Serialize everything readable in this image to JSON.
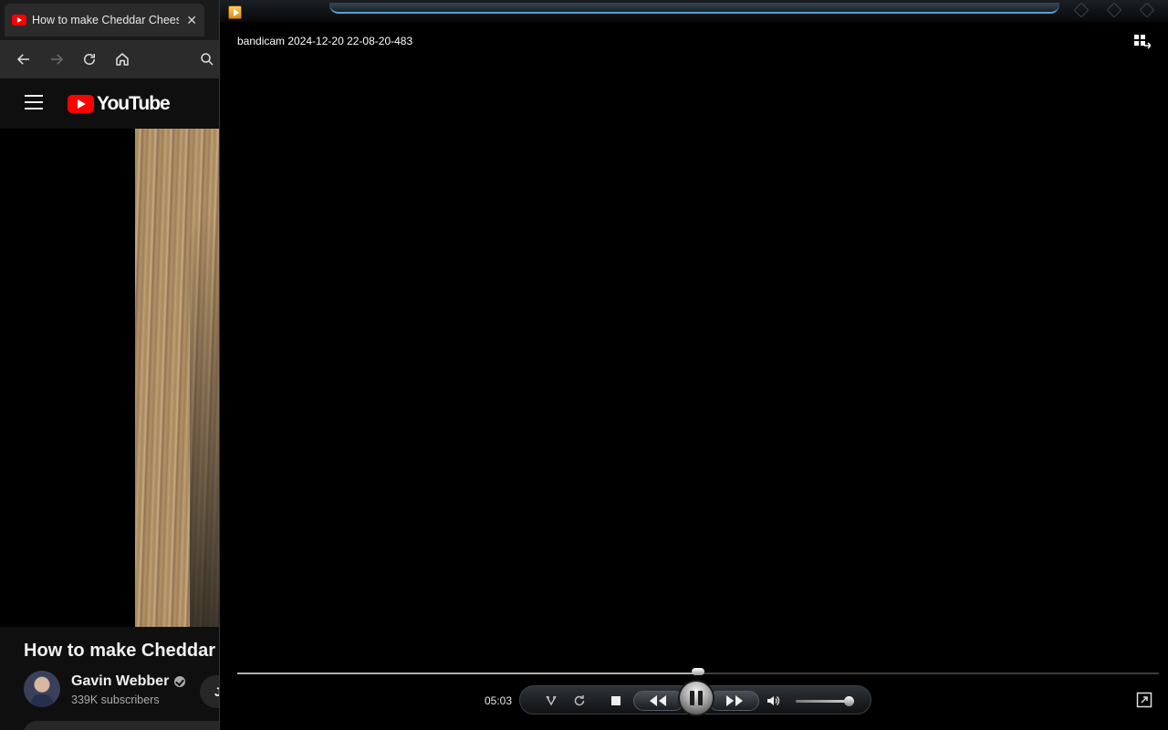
{
  "browser": {
    "tab_title": "How to make Cheddar Cheese",
    "tab_close_glyph": "✕",
    "icons": [
      "arrow-left-icon",
      "arrow-right-icon",
      "reload-icon",
      "home-icon",
      "search-icon"
    ]
  },
  "youtube": {
    "logo_text": "YouTube",
    "video_title": "How to make Cheddar C",
    "channel_name": "Gavin Webber",
    "subscribers": "339K subscribers",
    "join_button_partial": "J",
    "brand_color": "#ff0000"
  },
  "player": {
    "file_name": "bandicam 2024-12-20 22-08-20-483",
    "time": "05:03",
    "seek_progress": 0.5,
    "volume_level": 0.9,
    "state": "playing",
    "accent_color": "#5c9fd0"
  }
}
